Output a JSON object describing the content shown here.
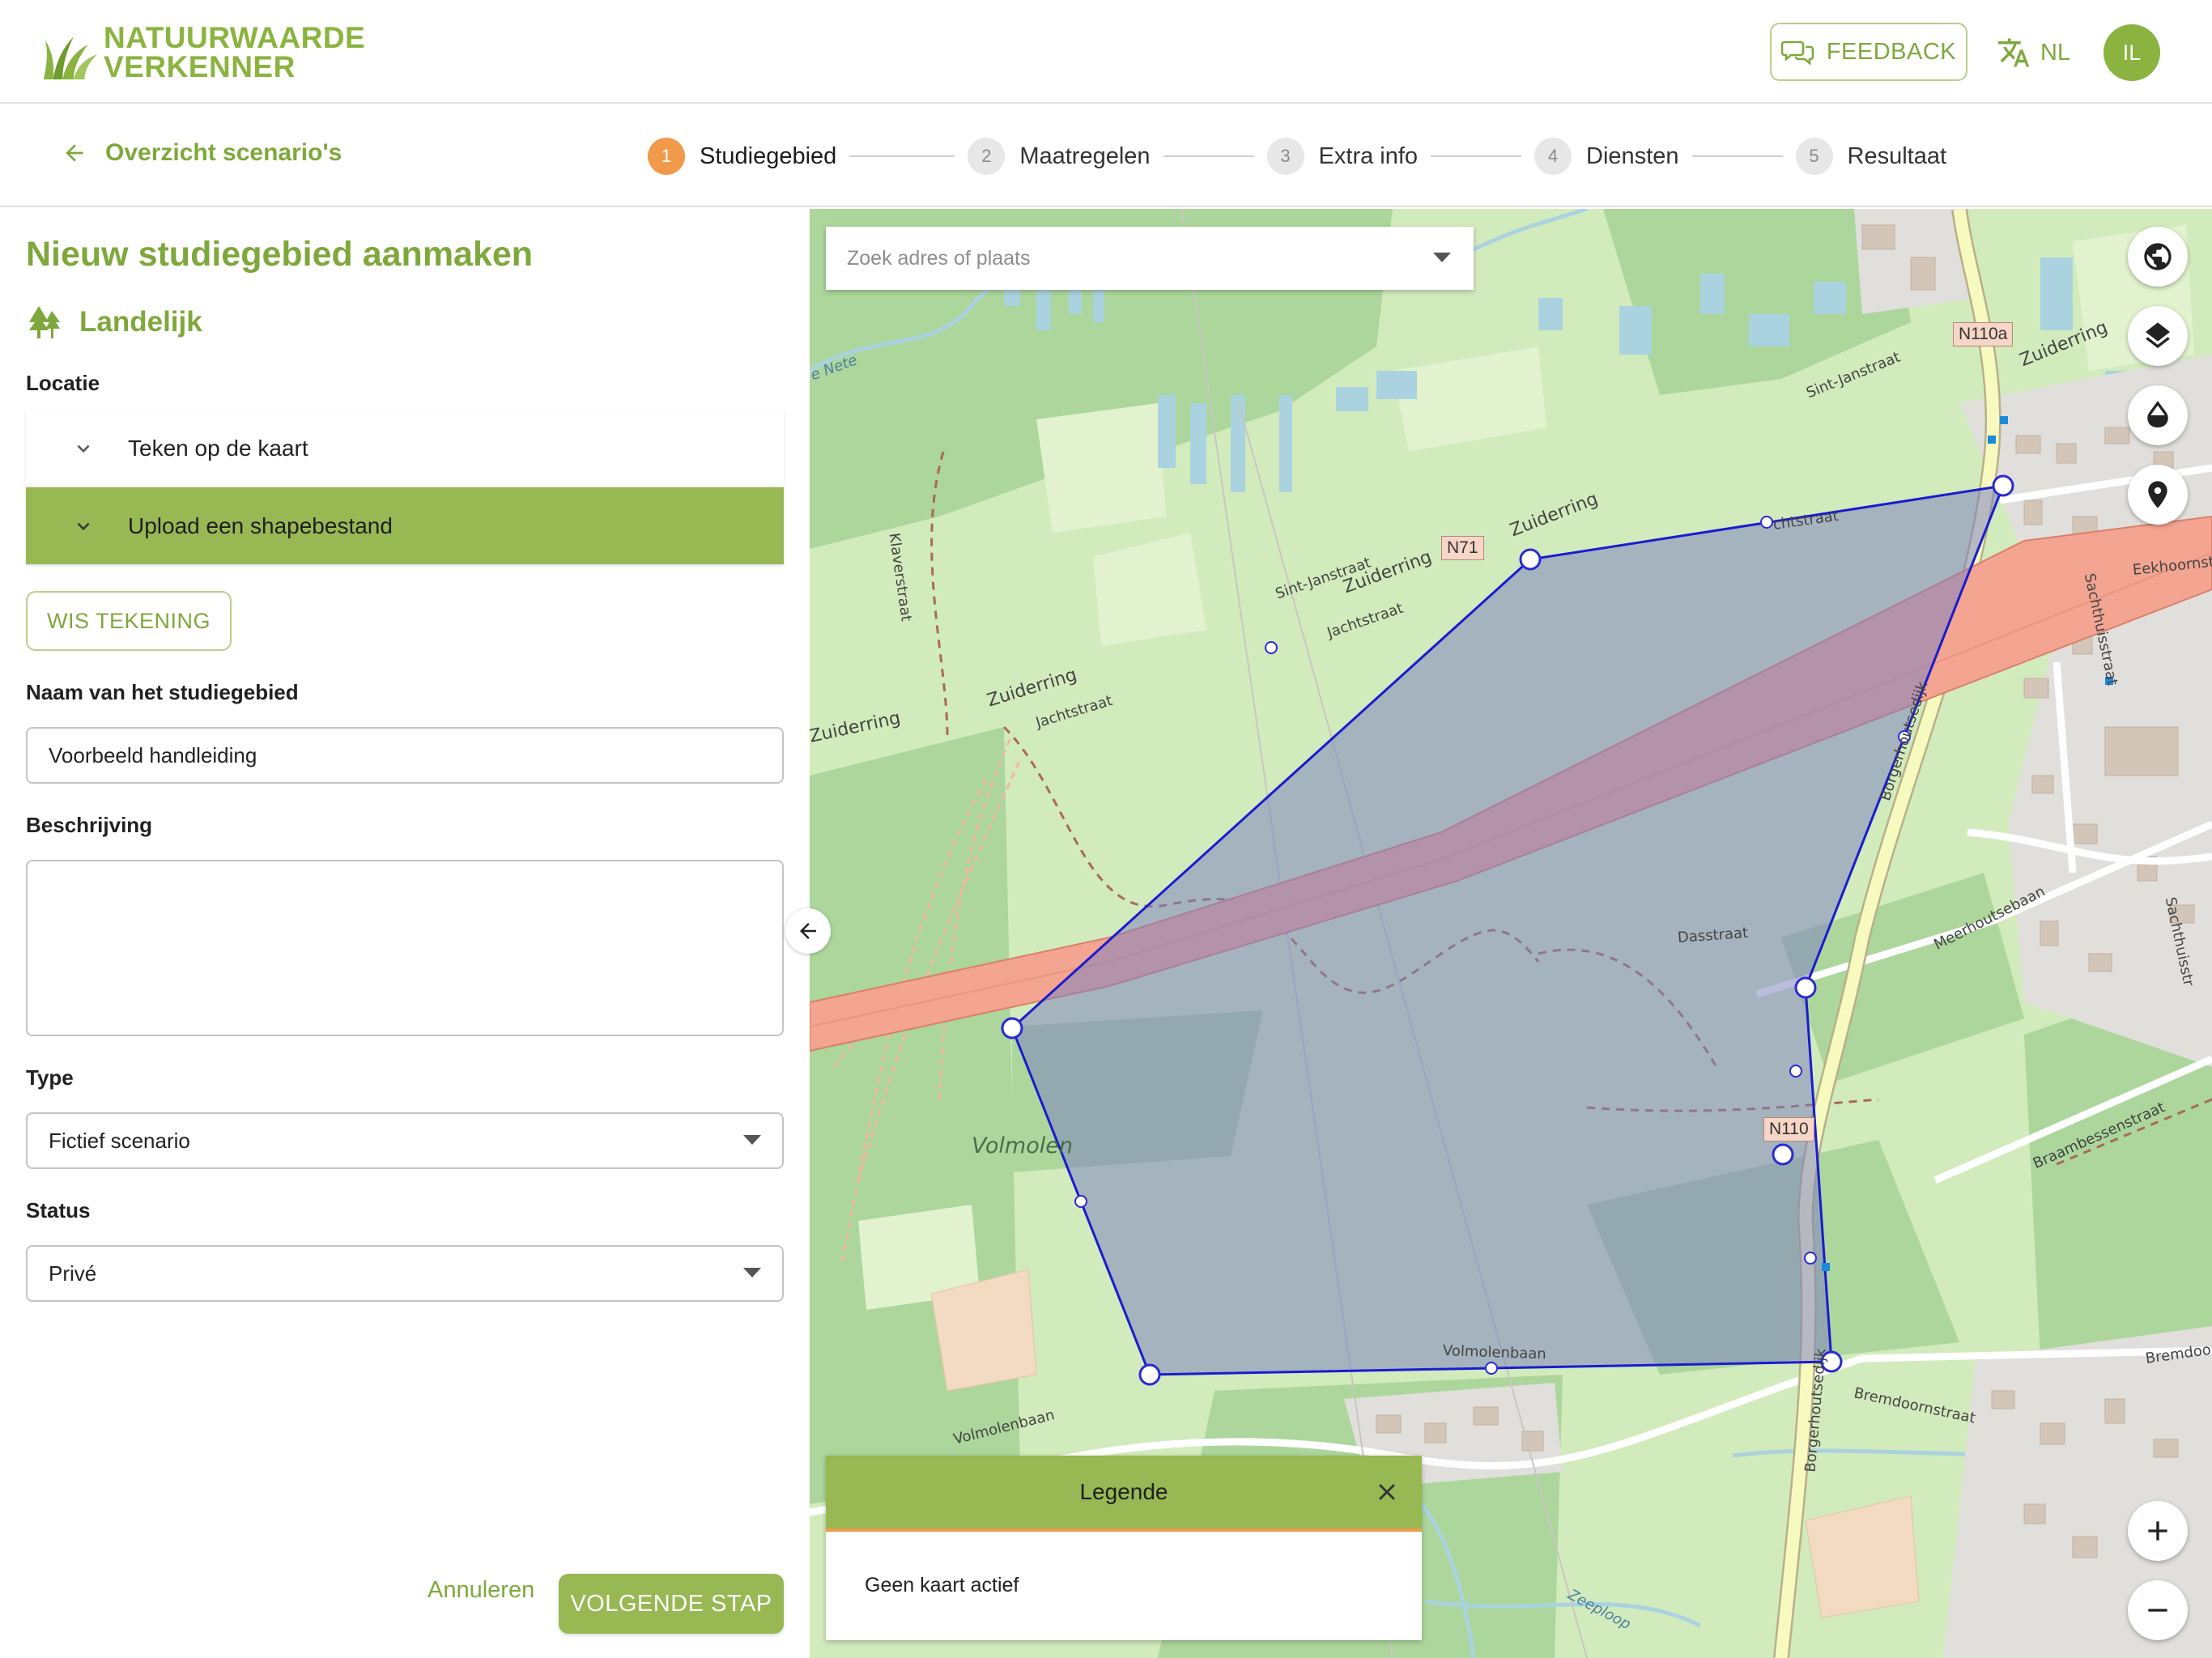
{
  "app": {
    "logo_line1": "NATUURWAARDE",
    "logo_line2": "VERKENNER",
    "feedback_label": "FEEDBACK",
    "language": "NL",
    "user_initials": "IL"
  },
  "nav": {
    "back_label": "Overzicht scenario's",
    "steps": [
      {
        "number": "1",
        "label": "Studiegebied",
        "active": true
      },
      {
        "number": "2",
        "label": "Maatregelen",
        "active": false
      },
      {
        "number": "3",
        "label": "Extra info",
        "active": false
      },
      {
        "number": "4",
        "label": "Diensten",
        "active": false
      },
      {
        "number": "5",
        "label": "Resultaat",
        "active": false
      }
    ]
  },
  "form": {
    "title": "Nieuw studiegebied aanmaken",
    "category": "Landelijk",
    "location_label": "Locatie",
    "location_options": [
      "Teken op de kaart",
      "Upload een shapebestand"
    ],
    "clear_drawing_label": "WIS TEKENING",
    "name_label": "Naam van het studiegebied",
    "name_value": "Voorbeeld handleiding",
    "description_label": "Beschrijving",
    "description_value": "",
    "type_label": "Type",
    "type_value": "Fictief scenario",
    "status_label": "Status",
    "status_value": "Privé",
    "cancel_label": "Annuleren",
    "next_label": "VOLGENDE STAP"
  },
  "map": {
    "search_placeholder": "Zoek adres of plaats",
    "legend_title": "Legende",
    "legend_empty": "Geen kaart actief",
    "labels": {
      "zuiderring_1": "Zuiderring",
      "zuiderring_2": "Zuiderring",
      "zuiderring_3": "Zuiderring",
      "zuiderring_4": "Zuiderring",
      "zuiderring_5": "Zuiderring",
      "sint_janstraat_1": "Sint-Janstraat",
      "sint_janstraat_2": "Sint-Janstraat",
      "jachtstraat_1": "Jachtstraat",
      "jachtstraat_2": "Jachtstraat",
      "jachtstraat_3": "chtstraat",
      "klaverstraat": "Klaverstraat",
      "volmolen": "Volmolen",
      "dasstraat": "Dasstraat",
      "volmolenbaan_1": "Volmolenbaan",
      "volmolenbaan_2": "Volmolenbaan",
      "borgerhoutsedijk_1": "Borgerhoutsedijk",
      "borgerhoutsedijk_2": "Borgerhoutsedijk",
      "meerhoutsebaan": "Meerhoutsebaan",
      "braambessenstraat": "Braambessenstraat",
      "bremdoornstraat": "Bremdoornstraat",
      "bremdoorn": "Bremdoorn",
      "sachthuisstraat_1": "Sachthuisstraat",
      "sachthuisstraat_2": "Sachthuisstr",
      "eekhoornstraat": "Eekhoornstr",
      "zeeploop": "Zeeploop",
      "nete": "e Nete",
      "shield_n71": "N71",
      "shield_n110a": "N110a",
      "shield_n110": "N110"
    }
  },
  "colors": {
    "brand_green": "#8ab43f",
    "accent_orange": "#f19a4c",
    "polygon_fill": "#8f95e8",
    "polygon_stroke": "#1a1acc"
  }
}
